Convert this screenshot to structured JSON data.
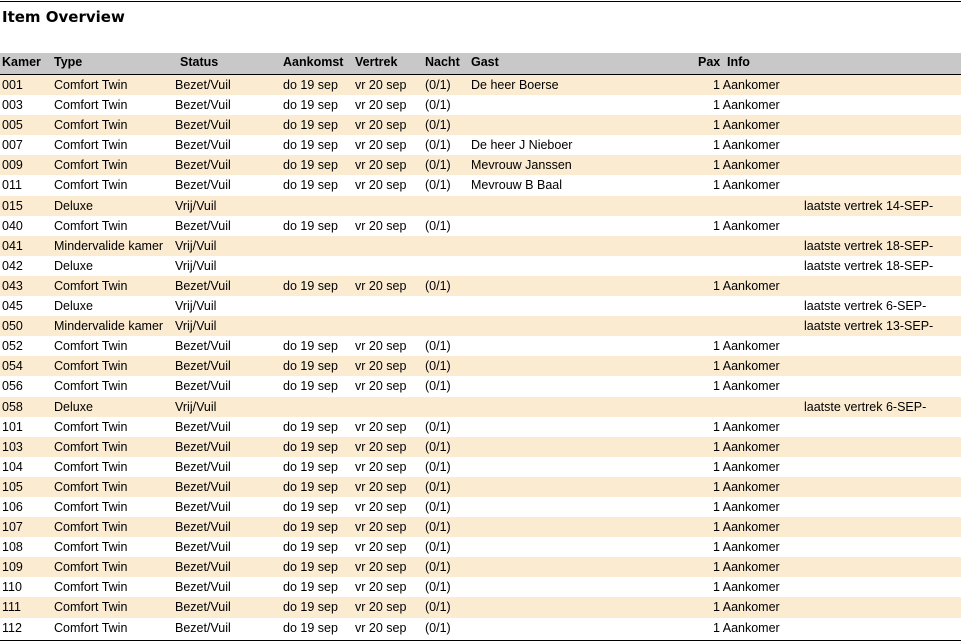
{
  "title": "Item Overview",
  "columns": {
    "kamer": "Kamer",
    "type": "Type",
    "status": "Status",
    "aankomst": "Aankomst",
    "vertrek": "Vertrek",
    "nacht": "Nacht",
    "gast": "Gast",
    "pax": "Pax",
    "info": "Info"
  },
  "colors": {
    "row_odd": "#fbebd1",
    "header": "#c8c8c8"
  },
  "rows": [
    {
      "kamer": "001",
      "type": "Comfort Twin",
      "status": "Bezet/Vuil",
      "aankomst": "do 19 sep",
      "vertrek": "vr 20 sep",
      "nacht": "(0/1)",
      "gast": "De heer Boerse",
      "pax": "1 Aankomer",
      "info": ""
    },
    {
      "kamer": "003",
      "type": "Comfort Twin",
      "status": "Bezet/Vuil",
      "aankomst": "do 19 sep",
      "vertrek": "vr 20 sep",
      "nacht": "(0/1)",
      "gast": "",
      "pax": "1 Aankomer",
      "info": ""
    },
    {
      "kamer": "005",
      "type": "Comfort Twin",
      "status": "Bezet/Vuil",
      "aankomst": "do 19 sep",
      "vertrek": "vr 20 sep",
      "nacht": "(0/1)",
      "gast": "",
      "pax": "1 Aankomer",
      "info": ""
    },
    {
      "kamer": "007",
      "type": "Comfort Twin",
      "status": "Bezet/Vuil",
      "aankomst": "do 19 sep",
      "vertrek": "vr 20 sep",
      "nacht": "(0/1)",
      "gast": "De heer J Nieboer",
      "pax": "1 Aankomer",
      "info": ""
    },
    {
      "kamer": "009",
      "type": "Comfort Twin",
      "status": "Bezet/Vuil",
      "aankomst": "do 19 sep",
      "vertrek": "vr 20 sep",
      "nacht": "(0/1)",
      "gast": "Mevrouw Janssen",
      "pax": "1 Aankomer",
      "info": ""
    },
    {
      "kamer": "011",
      "type": "Comfort Twin",
      "status": "Bezet/Vuil",
      "aankomst": "do 19 sep",
      "vertrek": "vr 20 sep",
      "nacht": "(0/1)",
      "gast": "Mevrouw B Baal",
      "pax": "1 Aankomer",
      "info": ""
    },
    {
      "kamer": "015",
      "type": "Deluxe",
      "status": "Vrij/Vuil",
      "aankomst": "",
      "vertrek": "",
      "nacht": "",
      "gast": "",
      "pax": "",
      "info": "laatste vertrek 14-SEP-"
    },
    {
      "kamer": "040",
      "type": "Comfort Twin",
      "status": "Bezet/Vuil",
      "aankomst": "do 19 sep",
      "vertrek": "vr 20 sep",
      "nacht": "(0/1)",
      "gast": "",
      "pax": "1 Aankomer",
      "info": ""
    },
    {
      "kamer": "041",
      "type": "Mindervalide kamer",
      "status": "Vrij/Vuil",
      "aankomst": "",
      "vertrek": "",
      "nacht": "",
      "gast": "",
      "pax": "",
      "info": "laatste vertrek 18-SEP-"
    },
    {
      "kamer": "042",
      "type": "Deluxe",
      "status": "Vrij/Vuil",
      "aankomst": "",
      "vertrek": "",
      "nacht": "",
      "gast": "",
      "pax": "",
      "info": "laatste vertrek 18-SEP-"
    },
    {
      "kamer": "043",
      "type": "Comfort Twin",
      "status": "Bezet/Vuil",
      "aankomst": "do 19 sep",
      "vertrek": "vr 20 sep",
      "nacht": "(0/1)",
      "gast": "",
      "pax": "1 Aankomer",
      "info": ""
    },
    {
      "kamer": "045",
      "type": "Deluxe",
      "status": "Vrij/Vuil",
      "aankomst": "",
      "vertrek": "",
      "nacht": "",
      "gast": "",
      "pax": "",
      "info": "laatste vertrek 6-SEP-"
    },
    {
      "kamer": "050",
      "type": "Mindervalide kamer",
      "status": "Vrij/Vuil",
      "aankomst": "",
      "vertrek": "",
      "nacht": "",
      "gast": "",
      "pax": "",
      "info": "laatste vertrek 13-SEP-"
    },
    {
      "kamer": "052",
      "type": "Comfort Twin",
      "status": "Bezet/Vuil",
      "aankomst": "do 19 sep",
      "vertrek": "vr 20 sep",
      "nacht": "(0/1)",
      "gast": "",
      "pax": "1 Aankomer",
      "info": ""
    },
    {
      "kamer": "054",
      "type": "Comfort Twin",
      "status": "Bezet/Vuil",
      "aankomst": "do 19 sep",
      "vertrek": "vr 20 sep",
      "nacht": "(0/1)",
      "gast": "",
      "pax": "1 Aankomer",
      "info": ""
    },
    {
      "kamer": "056",
      "type": "Comfort Twin",
      "status": "Bezet/Vuil",
      "aankomst": "do 19 sep",
      "vertrek": "vr 20 sep",
      "nacht": "(0/1)",
      "gast": "",
      "pax": "1 Aankomer",
      "info": ""
    },
    {
      "kamer": "058",
      "type": "Deluxe",
      "status": "Vrij/Vuil",
      "aankomst": "",
      "vertrek": "",
      "nacht": "",
      "gast": "",
      "pax": "",
      "info": "laatste vertrek 6-SEP-"
    },
    {
      "kamer": "101",
      "type": "Comfort Twin",
      "status": "Bezet/Vuil",
      "aankomst": "do 19 sep",
      "vertrek": "vr 20 sep",
      "nacht": "(0/1)",
      "gast": "",
      "pax": "1 Aankomer",
      "info": ""
    },
    {
      "kamer": "103",
      "type": "Comfort Twin",
      "status": "Bezet/Vuil",
      "aankomst": "do 19 sep",
      "vertrek": "vr 20 sep",
      "nacht": "(0/1)",
      "gast": "",
      "pax": "1 Aankomer",
      "info": ""
    },
    {
      "kamer": "104",
      "type": "Comfort Twin",
      "status": "Bezet/Vuil",
      "aankomst": "do 19 sep",
      "vertrek": "vr 20 sep",
      "nacht": "(0/1)",
      "gast": "",
      "pax": "1 Aankomer",
      "info": ""
    },
    {
      "kamer": "105",
      "type": "Comfort Twin",
      "status": "Bezet/Vuil",
      "aankomst": "do 19 sep",
      "vertrek": "vr 20 sep",
      "nacht": "(0/1)",
      "gast": "",
      "pax": "1 Aankomer",
      "info": ""
    },
    {
      "kamer": "106",
      "type": "Comfort Twin",
      "status": "Bezet/Vuil",
      "aankomst": "do 19 sep",
      "vertrek": "vr 20 sep",
      "nacht": "(0/1)",
      "gast": "",
      "pax": "1 Aankomer",
      "info": ""
    },
    {
      "kamer": "107",
      "type": "Comfort Twin",
      "status": "Bezet/Vuil",
      "aankomst": "do 19 sep",
      "vertrek": "vr 20 sep",
      "nacht": "(0/1)",
      "gast": "",
      "pax": "1 Aankomer",
      "info": ""
    },
    {
      "kamer": "108",
      "type": "Comfort Twin",
      "status": "Bezet/Vuil",
      "aankomst": "do 19 sep",
      "vertrek": "vr 20 sep",
      "nacht": "(0/1)",
      "gast": "",
      "pax": "1 Aankomer",
      "info": ""
    },
    {
      "kamer": "109",
      "type": "Comfort Twin",
      "status": "Bezet/Vuil",
      "aankomst": "do 19 sep",
      "vertrek": "vr 20 sep",
      "nacht": "(0/1)",
      "gast": "",
      "pax": "1 Aankomer",
      "info": ""
    },
    {
      "kamer": "110",
      "type": "Comfort Twin",
      "status": "Bezet/Vuil",
      "aankomst": "do 19 sep",
      "vertrek": "vr 20 sep",
      "nacht": "(0/1)",
      "gast": "",
      "pax": "1 Aankomer",
      "info": ""
    },
    {
      "kamer": "111",
      "type": "Comfort Twin",
      "status": "Bezet/Vuil",
      "aankomst": "do 19 sep",
      "vertrek": "vr 20 sep",
      "nacht": "(0/1)",
      "gast": "",
      "pax": "1 Aankomer",
      "info": ""
    },
    {
      "kamer": "112",
      "type": "Comfort Twin",
      "status": "Bezet/Vuil",
      "aankomst": "do 19 sep",
      "vertrek": "vr 20 sep",
      "nacht": "(0/1)",
      "gast": "",
      "pax": "1 Aankomer",
      "info": ""
    }
  ]
}
